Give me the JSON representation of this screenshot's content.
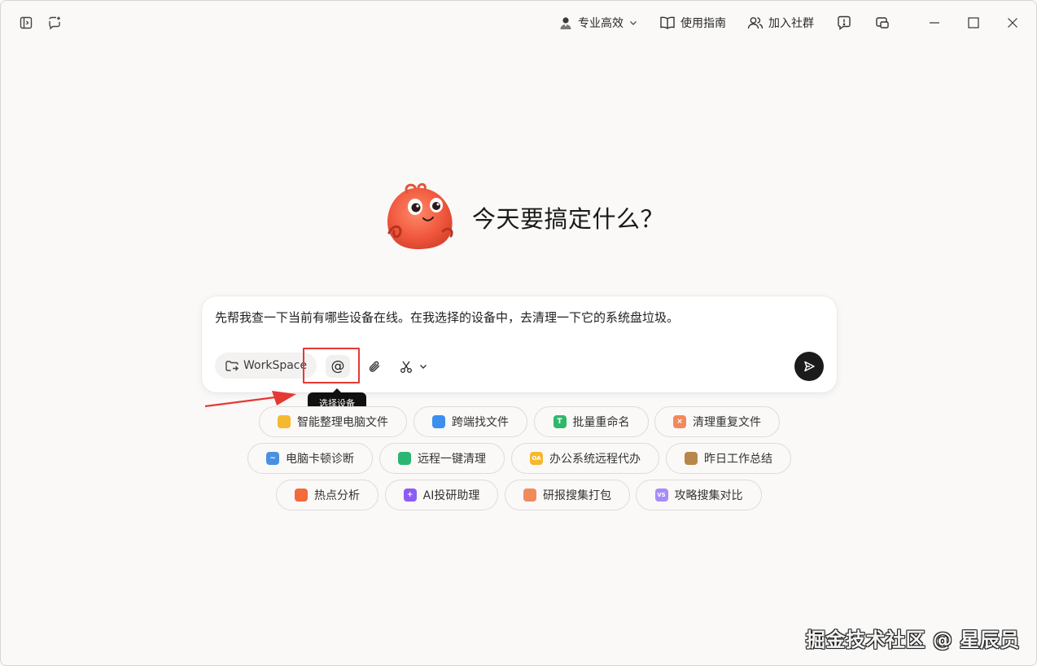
{
  "titlebar": {
    "mode_label": "专业高效",
    "guide_label": "使用指南",
    "community_label": "加入社群",
    "icons": [
      "sidebar-toggle-icon",
      "new-chat-icon",
      "user-avatar-icon",
      "chevron-down-icon",
      "book-icon",
      "people-icon",
      "feedback-icon",
      "pip-icon",
      "minimize-icon",
      "maximize-icon",
      "close-icon"
    ]
  },
  "hero": {
    "title": "今天要搞定什么？"
  },
  "input": {
    "text": "先帮我查一下当前有哪些设备在线。在我选择的设备中，去清理一下它的系统盘垃圾。",
    "workspace_label": "WorkSpace",
    "at_symbol": "@",
    "tooltip": "选择设备"
  },
  "suggestions": [
    {
      "label": "智能整理电脑文件",
      "icon": "folder-icon",
      "color": "#f5b82e",
      "glyph": ""
    },
    {
      "label": "跨端找文件",
      "icon": "search-file-icon",
      "color": "#3b8ff0",
      "glyph": ""
    },
    {
      "label": "批量重命名",
      "icon": "rename-icon",
      "color": "#2fb86a",
      "glyph": "T"
    },
    {
      "label": "清理重复文件",
      "icon": "duplicate-clean-icon",
      "color": "#f08a5d",
      "glyph": "×"
    },
    {
      "label": "电脑卡顿诊断",
      "icon": "monitor-icon",
      "color": "#4a90e2",
      "glyph": "~"
    },
    {
      "label": "远程一键清理",
      "icon": "broom-icon",
      "color": "#2bb673",
      "glyph": ""
    },
    {
      "label": "办公系统远程代办",
      "icon": "oa-icon",
      "color": "#f5b82e",
      "glyph": "OA"
    },
    {
      "label": "昨日工作总结",
      "icon": "briefcase-icon",
      "color": "#b8864a",
      "glyph": ""
    },
    {
      "label": "热点分析",
      "icon": "fire-icon",
      "color": "#f26b3a",
      "glyph": ""
    },
    {
      "label": "AI投研助理",
      "icon": "sparkle-icon",
      "color": "#8b5cf6",
      "glyph": "+"
    },
    {
      "label": "研报搜集打包",
      "icon": "package-icon",
      "color": "#f08a5d",
      "glyph": ""
    },
    {
      "label": "攻略搜集对比",
      "icon": "compare-icon",
      "color": "#a78bfa",
      "glyph": "VS"
    }
  ],
  "watermark": "掘金技术社区 @ 星辰员"
}
